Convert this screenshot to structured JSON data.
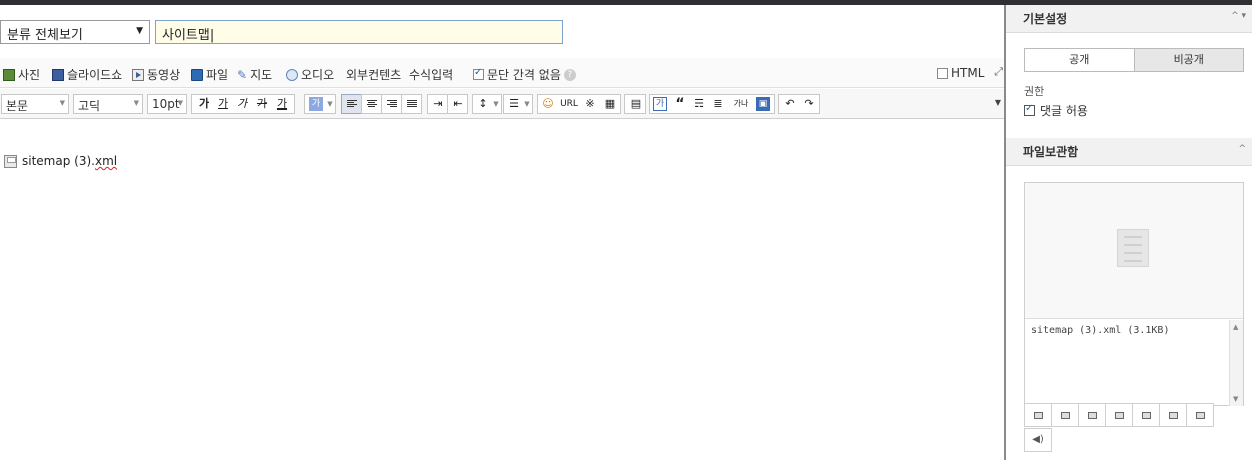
{
  "editor": {
    "category_select": "분류 전체보기",
    "title_value": "사이트맵|",
    "attach_toolbar": {
      "photo": "사진",
      "slideshow": "슬라이드쇼",
      "video": "동영상",
      "file": "파일",
      "map": "지도",
      "audio": "오디오",
      "external": "외부컨텐츠",
      "formula": "수식입력",
      "no_paragraph_spacing": "문단 간격 없음",
      "html": "HTML"
    },
    "format_toolbar": {
      "paragraph_style": "본문",
      "font": "고딕",
      "font_size": "10pt",
      "bold": "가",
      "underline": "가",
      "italic": "가",
      "strike": "가",
      "text_color": "가",
      "bg_color": "가",
      "url": "URL",
      "special_char": "※",
      "box": "가",
      "quote": "“",
      "char_spacing": "가나"
    },
    "attached_file": {
      "name_plain": "sitemap (3).",
      "name_ext": "xml",
      "icon": "disk-icon"
    }
  },
  "sidebar": {
    "basic_settings": {
      "title": "기본설정",
      "public_label": "공개",
      "private_label": "비공개",
      "permission_label": "권한",
      "allow_comments": "댓글 허용"
    },
    "file_storage": {
      "title": "파일보관함",
      "files": [
        "sitemap (3).xml (3.1KB)"
      ]
    }
  }
}
